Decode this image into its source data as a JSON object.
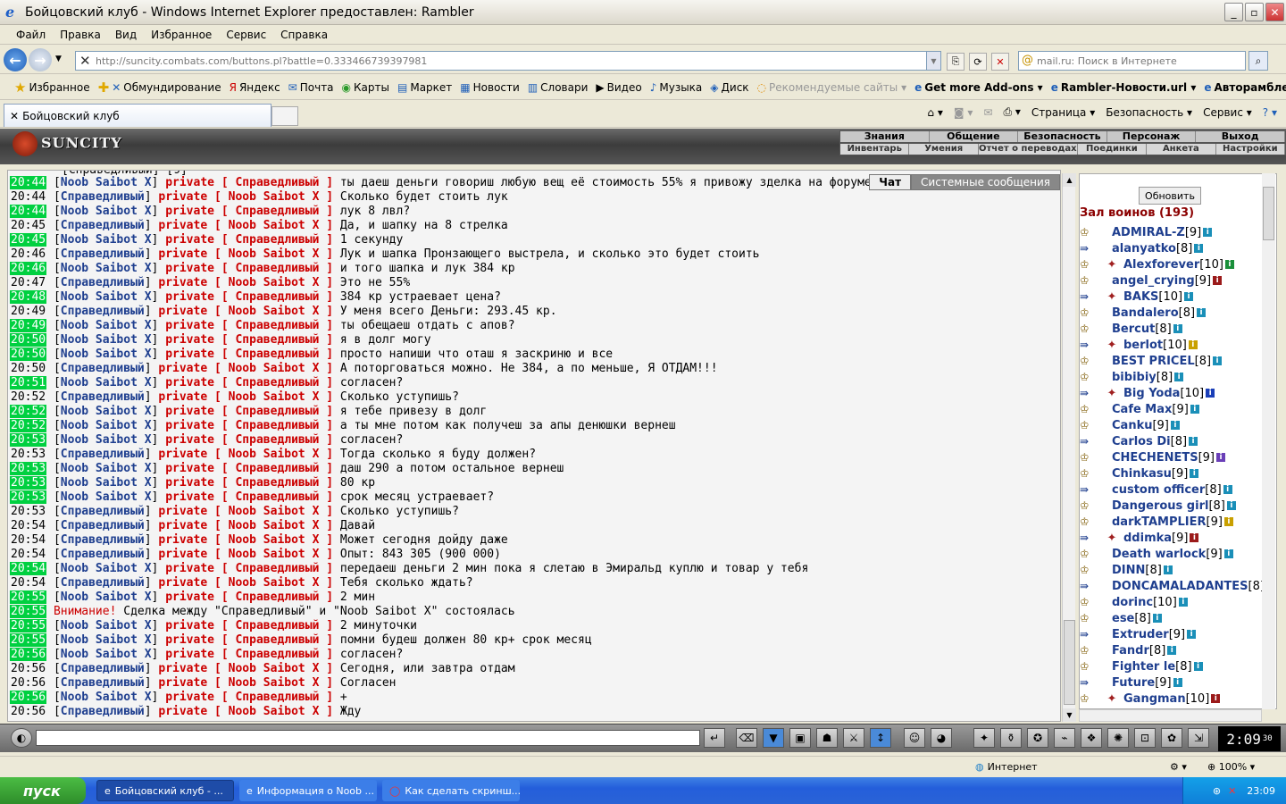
{
  "window": {
    "title": "Бойцовский клуб - Windows Internet Explorer предоставлен: Rambler"
  },
  "menubar": [
    "Файл",
    "Правка",
    "Вид",
    "Избранное",
    "Сервис",
    "Справка"
  ],
  "address": {
    "url": "http://suncity.combats.com/buttons.pl?battle=0.333466739397981",
    "search_placeholder": "mail.ru: Поиск в Интернете"
  },
  "favorites": [
    "Избранное",
    "Обмундирование",
    "Яндекс",
    "Почта",
    "Карты",
    "Маркет",
    "Новости",
    "Словари",
    "Видео",
    "Музыка",
    "Диск",
    "Рекомендуемые сайты",
    "Get more Add-ons",
    "Rambler-Новости.url",
    "Авторамблер"
  ],
  "tab": {
    "label": "Бойцовский клуб"
  },
  "tab_toolbar": [
    "Страница",
    "Безопасность",
    "Сервис"
  ],
  "game": {
    "logo": "SUNCITY",
    "menu_top": [
      "Знания",
      "Общение",
      "Безопасность",
      "Персонаж",
      "Выход"
    ],
    "menu_bottom": [
      "Инвентарь",
      "Умения",
      "Отчет о переводах",
      "Поединки",
      "Анкета",
      "Настройки"
    ],
    "chat_tabs": [
      "Чат",
      "Системные сообщения"
    ],
    "private_label": "private",
    "partial_top": "[Справедливый] [9]",
    "messages": [
      {
        "t": "20:44",
        "hl": true,
        "from": "Noob Saibot X",
        "to": "Справедливый",
        "text": "ты даеш деньги говориш любую вещ её стоимость 55% я привожу зделка на форуме."
      },
      {
        "t": "20:44",
        "hl": false,
        "from": "Справедливый",
        "to": "Noob Saibot X",
        "text": "Сколько будет стоить лук"
      },
      {
        "t": "20:44",
        "hl": true,
        "from": "Noob Saibot X",
        "to": "Справедливый",
        "text": "лук 8 лвл?"
      },
      {
        "t": "20:45",
        "hl": false,
        "from": "Справедливый",
        "to": "Noob Saibot X",
        "text": "Да, и шапку на 8 стрелка"
      },
      {
        "t": "20:45",
        "hl": true,
        "from": "Noob Saibot X",
        "to": "Справедливый",
        "text": "1 секунду"
      },
      {
        "t": "20:46",
        "hl": false,
        "from": "Справедливый",
        "to": "Noob Saibot X",
        "text": "Лук и шапка Пронзающего выстрела, и сколько это будет стоить"
      },
      {
        "t": "20:46",
        "hl": true,
        "from": "Noob Saibot X",
        "to": "Справедливый",
        "text": "и того шапка и лук 384 кр"
      },
      {
        "t": "20:47",
        "hl": false,
        "from": "Справедливый",
        "to": "Noob Saibot X",
        "text": "Это не 55%"
      },
      {
        "t": "20:48",
        "hl": true,
        "from": "Noob Saibot X",
        "to": "Справедливый",
        "text": "384 кр устраевает цена?"
      },
      {
        "t": "20:49",
        "hl": false,
        "from": "Справедливый",
        "to": "Noob Saibot X",
        "text": "У меня всего Деньги: 293.45 кр."
      },
      {
        "t": "20:49",
        "hl": true,
        "from": "Noob Saibot X",
        "to": "Справедливый",
        "text": "ты обещаеш отдать с апов?"
      },
      {
        "t": "20:50",
        "hl": true,
        "from": "Noob Saibot X",
        "to": "Справедливый",
        "text": "я в долг могу"
      },
      {
        "t": "20:50",
        "hl": true,
        "from": "Noob Saibot X",
        "to": "Справедливый",
        "text": "просто напиши что оташ я заскриню и все"
      },
      {
        "t": "20:50",
        "hl": false,
        "from": "Справедливый",
        "to": "Noob Saibot X",
        "text": "А поторговаться можно. Не 384, а по меньше, Я ОТДАМ!!!"
      },
      {
        "t": "20:51",
        "hl": true,
        "from": "Noob Saibot X",
        "to": "Справедливый",
        "text": "согласен?"
      },
      {
        "t": "20:52",
        "hl": false,
        "from": "Справедливый",
        "to": "Noob Saibot X",
        "text": "Сколько уступишь?"
      },
      {
        "t": "20:52",
        "hl": true,
        "from": "Noob Saibot X",
        "to": "Справедливый",
        "text": "я тебе привезу в долг"
      },
      {
        "t": "20:52",
        "hl": true,
        "from": "Noob Saibot X",
        "to": "Справедливый",
        "text": "а ты мне потом как получеш за апы денюшки вернеш"
      },
      {
        "t": "20:53",
        "hl": true,
        "from": "Noob Saibot X",
        "to": "Справедливый",
        "text": "согласен?"
      },
      {
        "t": "20:53",
        "hl": false,
        "from": "Справедливый",
        "to": "Noob Saibot X",
        "text": "Тогда сколько я буду должен?"
      },
      {
        "t": "20:53",
        "hl": true,
        "from": "Noob Saibot X",
        "to": "Справедливый",
        "text": "даш 290 а потом остальное вернеш"
      },
      {
        "t": "20:53",
        "hl": true,
        "from": "Noob Saibot X",
        "to": "Справедливый",
        "text": "80 кр"
      },
      {
        "t": "20:53",
        "hl": true,
        "from": "Noob Saibot X",
        "to": "Справедливый",
        "text": "срок месяц устраевает?"
      },
      {
        "t": "20:53",
        "hl": false,
        "from": "Справедливый",
        "to": "Noob Saibot X",
        "text": "Сколько уступишь?"
      },
      {
        "t": "20:54",
        "hl": false,
        "from": "Справедливый",
        "to": "Noob Saibot X",
        "text": "Давай"
      },
      {
        "t": "20:54",
        "hl": false,
        "from": "Справедливый",
        "to": "Noob Saibot X",
        "text": "Может сегодня дойду даже"
      },
      {
        "t": "20:54",
        "hl": false,
        "from": "Справедливый",
        "to": "Noob Saibot X",
        "text": "Опыт: 843 305 (900 000)"
      },
      {
        "t": "20:54",
        "hl": true,
        "from": "Noob Saibot X",
        "to": "Справедливый",
        "text": "передаеш деньги 2 мин пока я слетаю в Эмиральд куплю и товар у тебя"
      },
      {
        "t": "20:54",
        "hl": false,
        "from": "Справедливый",
        "to": "Noob Saibot X",
        "text": "Тебя сколько ждать?"
      },
      {
        "t": "20:55",
        "hl": true,
        "from": "Noob Saibot X",
        "to": "Справедливый",
        "text": "2 мин"
      },
      {
        "t": "20:55",
        "hl": true,
        "system": true,
        "warn": "Внимание!",
        "text": "Сделка между \"Справедливый\" и \"Noob Saibot X\" состоялась"
      },
      {
        "t": "20:55",
        "hl": true,
        "from": "Noob Saibot X",
        "to": "Справедливый",
        "text": "2 минуточки"
      },
      {
        "t": "20:55",
        "hl": true,
        "from": "Noob Saibot X",
        "to": "Справедливый",
        "text": "помни будеш должен 80 кр+ срок месяц"
      },
      {
        "t": "20:56",
        "hl": true,
        "from": "Noob Saibot X",
        "to": "Справедливый",
        "text": "согласен?"
      },
      {
        "t": "20:56",
        "hl": false,
        "from": "Справедливый",
        "to": "Noob Saibot X",
        "text": "Сегодня, или завтра отдам"
      },
      {
        "t": "20:56",
        "hl": false,
        "from": "Справедливый",
        "to": "Noob Saibot X",
        "text": "Согласен"
      },
      {
        "t": "20:56",
        "hl": true,
        "from": "Noob Saibot X",
        "to": "Справедливый",
        "text": "+"
      },
      {
        "t": "20:56",
        "hl": false,
        "from": "Справедливый",
        "to": "Noob Saibot X",
        "text": "Жду"
      }
    ],
    "users_panel": {
      "refresh": "Обновить",
      "hall_title": "Зал воинов (193)",
      "users": [
        {
          "name": "ADMIRAL-Z",
          "lvl": "[9]",
          "clan": false,
          "info": "#1a8fb8"
        },
        {
          "name": "alanyatko",
          "lvl": "[8]",
          "clan": false,
          "info": "#1a8fb8"
        },
        {
          "name": "Alexforever",
          "lvl": "[10]",
          "clan": true,
          "info": "#1a8f3a"
        },
        {
          "name": "angel_crying",
          "lvl": "[9]",
          "clan": false,
          "info": "#9b1a1a"
        },
        {
          "name": "BAKS",
          "lvl": "[10]",
          "clan": true,
          "info": "#1a8fb8"
        },
        {
          "name": "Bandalero",
          "lvl": "[8]",
          "clan": false,
          "info": "#1a8fb8"
        },
        {
          "name": "Bercut",
          "lvl": "[8]",
          "clan": false,
          "info": "#1a8fb8"
        },
        {
          "name": "berlot",
          "lvl": "[10]",
          "clan": true,
          "info": "#c9a000"
        },
        {
          "name": "BEST PRICEL",
          "lvl": "[8]",
          "clan": false,
          "info": "#1a8fb8"
        },
        {
          "name": "bibibiy",
          "lvl": "[8]",
          "clan": false,
          "info": "#1a8fb8"
        },
        {
          "name": "Big Yoda",
          "lvl": "[10]",
          "clan": true,
          "info": "#1a3fb8"
        },
        {
          "name": "Cafe Max",
          "lvl": "[9]",
          "clan": false,
          "info": "#1a8fb8"
        },
        {
          "name": "Canku",
          "lvl": "[9]",
          "clan": false,
          "info": "#1a8fb8"
        },
        {
          "name": "Carlos Di",
          "lvl": "[8]",
          "clan": false,
          "info": "#1a8fb8"
        },
        {
          "name": "CHECHENETS",
          "lvl": "[9]",
          "clan": false,
          "info": "#6a3fb8"
        },
        {
          "name": "Chinkasu",
          "lvl": "[9]",
          "clan": false,
          "info": "#1a8fb8"
        },
        {
          "name": "custom officer",
          "lvl": "[8]",
          "clan": false,
          "info": "#1a8fb8"
        },
        {
          "name": "Dangerous girl",
          "lvl": "[8]",
          "clan": false,
          "info": "#1a8fb8"
        },
        {
          "name": "darkTAMPLIER",
          "lvl": "[9]",
          "clan": false,
          "info": "#c9a000"
        },
        {
          "name": "ddimka",
          "lvl": "[9]",
          "clan": true,
          "info": "#9b1a1a"
        },
        {
          "name": "Death warlock",
          "lvl": "[9]",
          "clan": false,
          "info": "#1a8fb8"
        },
        {
          "name": "DINN",
          "lvl": "[8]",
          "clan": false,
          "info": "#1a8fb8"
        },
        {
          "name": "DONCAMALADANTES",
          "lvl": "[8]",
          "clan": false,
          "info": ""
        },
        {
          "name": "dorinc",
          "lvl": "[10]",
          "clan": false,
          "info": "#1a8fb8"
        },
        {
          "name": "ese",
          "lvl": "[8]",
          "clan": false,
          "info": "#1a8fb8"
        },
        {
          "name": "Extruder",
          "lvl": "[9]",
          "clan": false,
          "info": "#1a8fb8"
        },
        {
          "name": "Fandr",
          "lvl": "[8]",
          "clan": false,
          "info": "#1a8fb8"
        },
        {
          "name": "Fighter le",
          "lvl": "[8]",
          "clan": false,
          "info": "#1a8fb8"
        },
        {
          "name": "Future",
          "lvl": "[9]",
          "clan": false,
          "info": "#1a8fb8"
        },
        {
          "name": "Gangman",
          "lvl": "[10]",
          "clan": true,
          "info": "#9b1a1a"
        }
      ]
    },
    "clock": "2:09",
    "clock_sec": "30"
  },
  "statusbar": {
    "zone": "Интернет",
    "zoom": "100%"
  },
  "taskbar": {
    "start": "пуск",
    "tasks": [
      "Бойцовский клуб - ...",
      "Информация о Noob ...",
      "Как сделать скринш..."
    ],
    "lang": "RU",
    "time": "23:09"
  },
  "colors": {
    "time_highlight": "#00d040",
    "nick": "#1f3f8f",
    "private": "#cc0000",
    "hall_title": "#8b0000"
  }
}
